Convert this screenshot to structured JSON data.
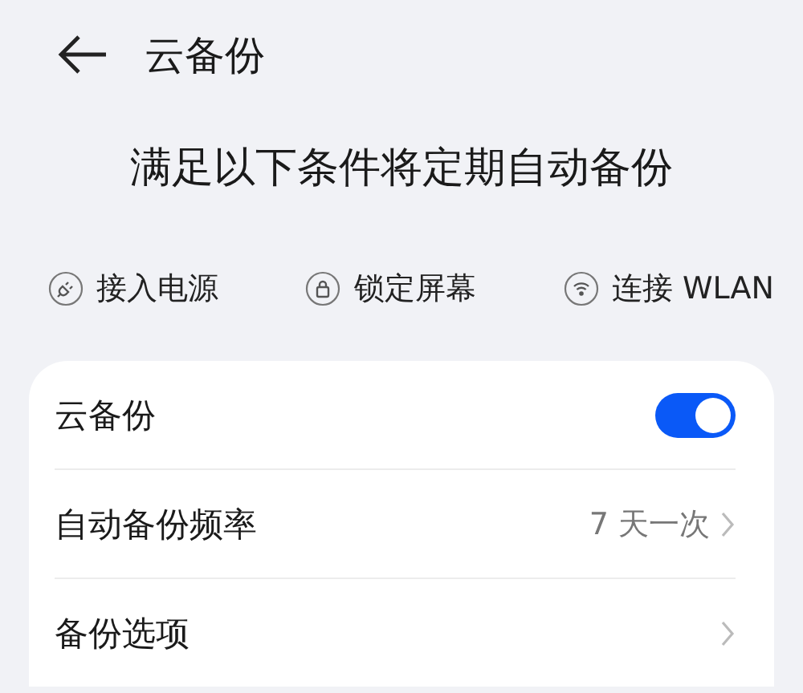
{
  "header": {
    "title": "云备份"
  },
  "heading": "满足以下条件将定期自动备份",
  "conditions": [
    {
      "kind": "power",
      "label": "接入电源"
    },
    {
      "kind": "lock",
      "label": "锁定屏幕"
    },
    {
      "kind": "wifi",
      "label": "连接 WLAN"
    }
  ],
  "settings": [
    {
      "kind": "toggle",
      "label": "云备份",
      "on": true
    },
    {
      "kind": "link",
      "label": "自动备份频率",
      "value": "7 天一次"
    },
    {
      "kind": "link",
      "label": "备份选项"
    }
  ]
}
